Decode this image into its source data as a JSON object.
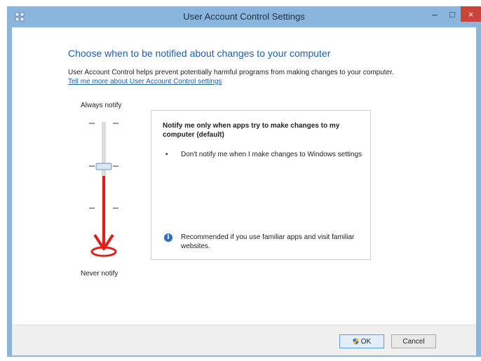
{
  "window": {
    "title": "User Account Control Settings"
  },
  "controls": {
    "minimize": "–",
    "maximize": "□",
    "close": "×"
  },
  "main": {
    "heading": "Choose when to be notified about changes to your computer",
    "description": "User Account Control helps prevent potentially harmful programs from making changes to your computer.",
    "link": "Tell me more about User Account Control settings"
  },
  "slider": {
    "top_label": "Always notify",
    "bottom_label": "Never notify",
    "levels": 4,
    "selected_level": 3,
    "annotation_color": "#e0201b"
  },
  "panel": {
    "title": "Notify me only when apps try to make changes to my computer (default)",
    "bullet": "Don't notify me when I make changes to Windows settings",
    "info": "Recommended if you use familiar apps and visit familiar websites."
  },
  "footer": {
    "ok_label": "OK",
    "cancel_label": "Cancel"
  },
  "colors": {
    "accent": "#1e5fa8",
    "titlebar": "#8ab6de",
    "close": "#c9453a"
  }
}
